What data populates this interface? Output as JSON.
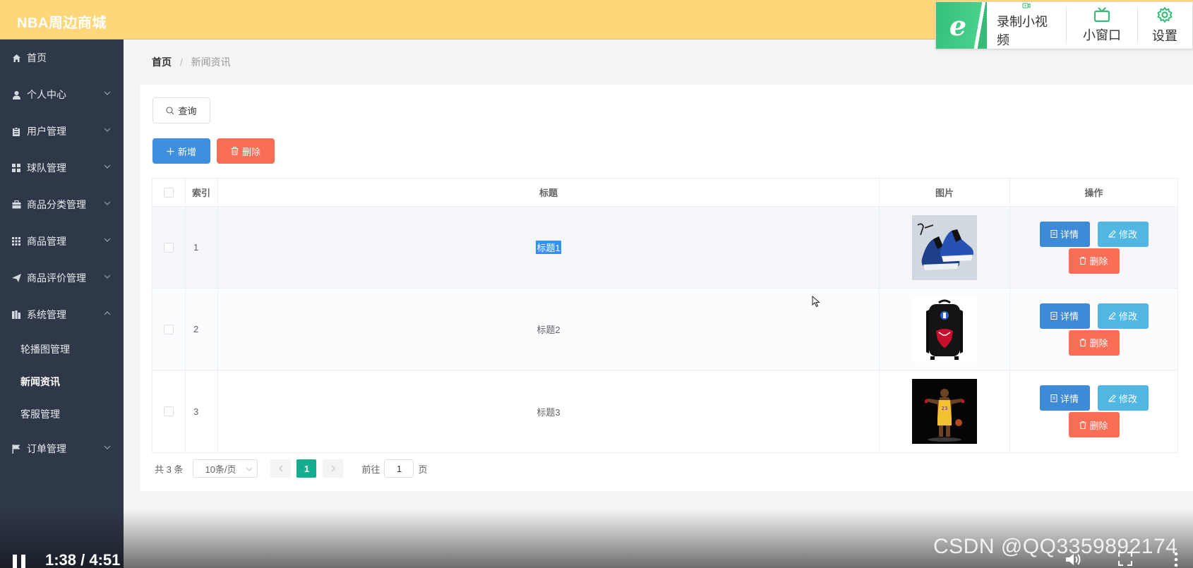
{
  "app": {
    "title": "NBA周边商城"
  },
  "recorder": {
    "logo": "e",
    "record_label": "录制小视频",
    "mini_window_label": "小窗口",
    "settings_label": "设置",
    "accent": "#36bc78"
  },
  "sidebar": {
    "items": [
      {
        "label": "首页",
        "icon": "home-icon"
      },
      {
        "label": "个人中心",
        "icon": "user-icon"
      },
      {
        "label": "用户管理",
        "icon": "clipboard-icon"
      },
      {
        "label": "球队管理",
        "icon": "grid-icon"
      },
      {
        "label": "商品分类管理",
        "icon": "briefcase-icon"
      },
      {
        "label": "商品管理",
        "icon": "apps-icon"
      },
      {
        "label": "商品评价管理",
        "icon": "send-icon"
      },
      {
        "label": "系统管理",
        "icon": "office-icon"
      },
      {
        "label": "订单管理",
        "icon": "flag-icon"
      }
    ],
    "system_sub": [
      "轮播图管理",
      "新闻资讯",
      "客服管理"
    ]
  },
  "breadcrumb": {
    "home": "首页",
    "separator": "/",
    "current": "新闻资讯"
  },
  "toolbar": {
    "query_label": "查询",
    "add_label": "新增",
    "delete_label": "删除"
  },
  "table": {
    "headers": {
      "index": "索引",
      "title": "标题",
      "image": "图片",
      "actions": "操作"
    },
    "rows": [
      {
        "index": "1",
        "title": "标题1"
      },
      {
        "index": "2",
        "title": "标题2"
      },
      {
        "index": "3",
        "title": "标题3"
      }
    ],
    "actions": {
      "detail": "详情",
      "edit": "修改",
      "delete": "删除"
    }
  },
  "pagination": {
    "total_text": "共 3 条",
    "page_size": "10条/页",
    "current_page": "1",
    "goto_label": "前往",
    "goto_value": "1",
    "page_suffix": "页"
  },
  "video": {
    "time": "1:38 / 4:51",
    "watermark": "CSDN @QQ3359892174"
  },
  "colors": {
    "header": "#ffd77a",
    "sidebar": "#2f3849",
    "primary": "#3f8fe0",
    "danger": "#fa6e57",
    "info": "#52b6e2",
    "page_active": "#13ae8f"
  }
}
